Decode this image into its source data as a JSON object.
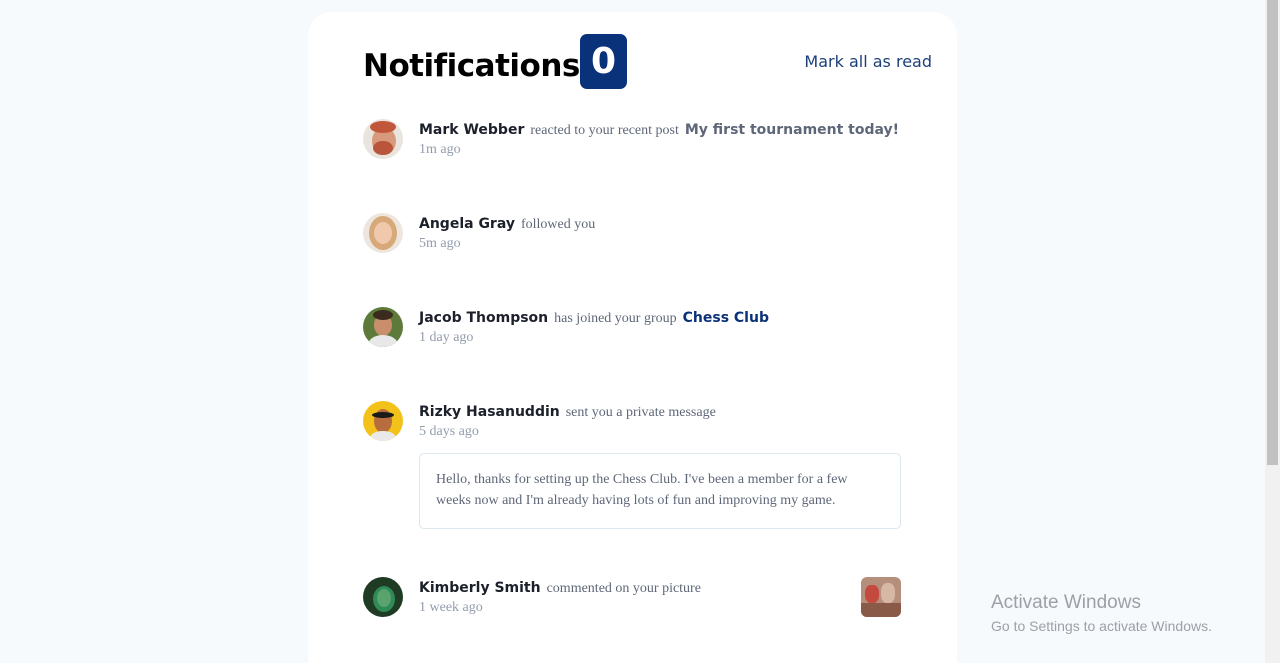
{
  "header": {
    "title": "Notifications",
    "unread_count": "0",
    "mark_all_label": "Mark all as read"
  },
  "notifications": [
    {
      "name": "Mark Webber",
      "action": "reacted to your recent post",
      "target": "My first tournament today!",
      "time": "1m ago",
      "avatar": "avatar-mark-webber"
    },
    {
      "name": "Angela Gray",
      "action": "followed you",
      "time": "5m ago",
      "avatar": "avatar-angela-gray"
    },
    {
      "name": "Jacob Thompson",
      "action": "has joined your group",
      "target": "Chess Club",
      "time": "1 day ago",
      "avatar": "avatar-jacob-thompson"
    },
    {
      "name": "Rizky Hasanuddin",
      "action": "sent you a private message",
      "time": "5 days ago",
      "message": "Hello, thanks for setting up the Chess Club. I've been a member for a few weeks now and I'm already having lots of fun and improving my game.",
      "avatar": "avatar-rizky-hasanuddin"
    },
    {
      "name": "Kimberly Smith",
      "action": "commented on your picture",
      "time": "1 week ago",
      "avatar": "avatar-kimberly-smith",
      "picture": "chess-picture-thumbnail"
    }
  ],
  "watermark": {
    "line1": "Activate Windows",
    "line2": "Go to Settings to activate Windows."
  },
  "colors": {
    "page_bg": "#f7fafd",
    "card_bg": "#ffffff",
    "badge_bg": "#0a327b",
    "dark_text": "#1c202b",
    "grey_text": "#5e6778",
    "light_grey_text": "#939cad",
    "blue_link": "#0a327b"
  }
}
